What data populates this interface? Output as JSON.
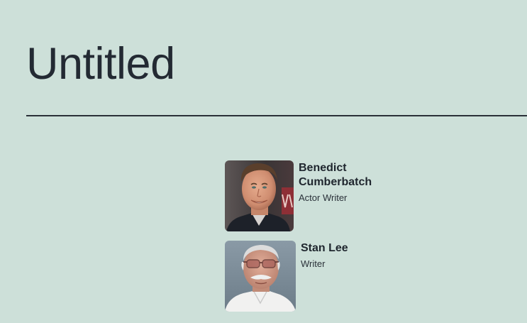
{
  "page": {
    "title": "Untitled"
  },
  "people": [
    {
      "name": "Benedict Cumberbatch",
      "roles": "Actor Writer",
      "photo_icon": "portrait-photo"
    },
    {
      "name": "Stan Lee",
      "roles": "Writer",
      "photo_icon": "portrait-photo"
    }
  ],
  "colors": {
    "background": "#cde0d9",
    "text": "#232a33",
    "divider": "#2a3038"
  }
}
